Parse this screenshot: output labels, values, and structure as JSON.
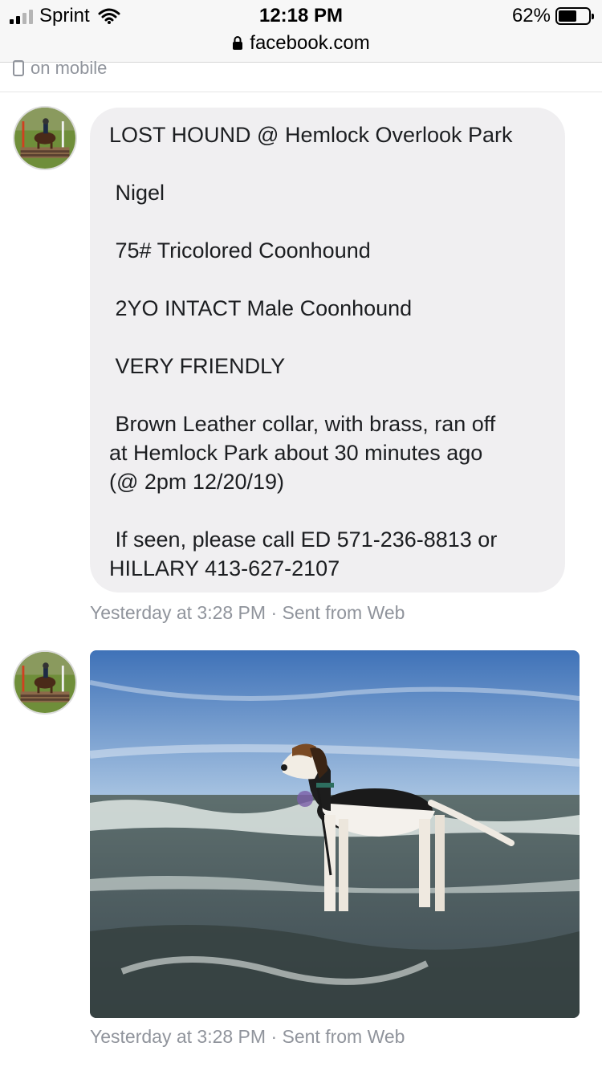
{
  "status_bar": {
    "carrier": "Sprint",
    "time": "12:18 PM",
    "battery_percent": "62%",
    "battery_level": 0.62,
    "url": "facebook.com"
  },
  "prev_message": {
    "text": "on mobile"
  },
  "messages": [
    {
      "lines": [
        "LOST HOUND @ Hemlock Overlook Park",
        "",
        " Nigel",
        "",
        " 75# Tricolored Coonhound",
        "",
        " 2YO INTACT Male Coonhound",
        "",
        " VERY FRIENDLY",
        "",
        " Brown Leather collar, with brass, ran off",
        "at Hemlock Park about 30 minutes ago",
        "(@ 2pm 12/20/19)",
        "",
        " If seen, please call ED 571-236-8813 or",
        "HILLARY 413-627-2107"
      ],
      "meta": "Yesterday at 3:28 PM · Sent from Web"
    },
    {
      "image": "photo of tricolored coonhound standing in surf",
      "meta": "Yesterday at 3:28 PM · Sent from Web"
    }
  ],
  "colors": {
    "bubble": "#f0eff1",
    "meta_text": "#90949c",
    "text": "#1c1e21"
  }
}
